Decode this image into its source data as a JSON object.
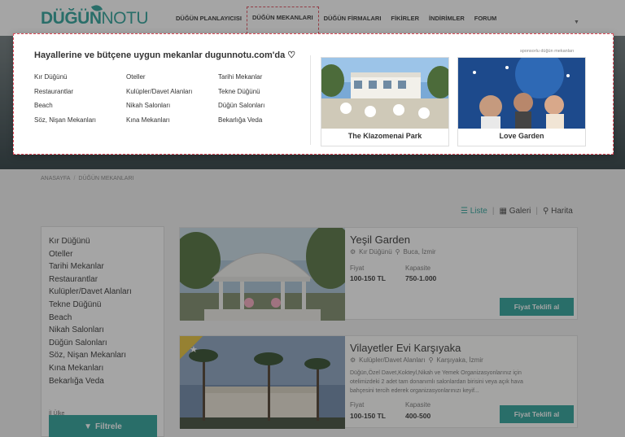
{
  "header": {
    "logo_main": "DÜĞÜN",
    "logo_second": "NOTU",
    "nav": [
      {
        "label": "DÜĞÜN PLANLAYICISI"
      },
      {
        "label": "DÜĞÜN MEKANLARI"
      },
      {
        "label": "DÜĞÜN FİRMALARI"
      },
      {
        "label": "FİKİRLER"
      },
      {
        "label": "İNDİRİMLER"
      },
      {
        "label": "FORUM"
      }
    ]
  },
  "mega_menu": {
    "title": "Hayallerine ve bütçene uygun mekanlar dugunnotu.com'da ♡",
    "col1": [
      "Kır Düğünü",
      "Restaurantlar",
      "Beach",
      "Söz, Nişan Mekanları"
    ],
    "col2": [
      "Oteller",
      "Kulüpler/Davet Alanları",
      "Nikah Salonları",
      "Kına Mekanları"
    ],
    "col3": [
      "Tarihi Mekanlar",
      "Tekne Düğünü",
      "Düğün Salonları",
      "Bekarlığa Veda"
    ],
    "sponsor_label": "sponsorlu düğün mekanları",
    "sponsors": [
      {
        "name": "The Klazomenai Park"
      },
      {
        "name": "Love Garden"
      }
    ]
  },
  "breadcrumb": {
    "home": "ANASAYFA",
    "sep": "/",
    "current": "DÜĞÜN MEKANLARI"
  },
  "view_switch": {
    "list": "Liste",
    "gallery": "Galeri",
    "map": "Harita",
    "bar": "|"
  },
  "sidebar": {
    "items": [
      "Kır Düğünü",
      "Oteller",
      "Tarihi Mekanlar",
      "Restaurantlar",
      "Kulüpler/Davet Alanları",
      "Tekne Düğünü",
      "Beach",
      "Nikah Salonları",
      "Düğün Salonları",
      "Söz, Nişan Mekanları",
      "Kına Mekanları",
      "Bekarlığa Veda"
    ],
    "extra": "İl Ülke",
    "filter_label": "Filtrele"
  },
  "listings": [
    {
      "title": "Yeşil Garden",
      "category": "Kır Düğünü",
      "location": "Buca, İzmir",
      "description": "",
      "price_label": "Fiyat",
      "price": "100-150 TL",
      "capacity_label": "Kapasite",
      "capacity": "750-1.000",
      "button": "Fiyat Teklifi al"
    },
    {
      "title": "Vilayetler Evi Karşıyaka",
      "category": "Kulüpler/Davet Alanları",
      "location": "Karşıyaka, İzmir",
      "description": "Düğün,Özel Davet,Kokteyl,Nikah ve Yemek Organizasyonlarınız için otelimizdeki 2 adet tam donanımlı salonlardan birisini veya açık hava bahçesini tercih ederek organizasyonlarınızı keyif...",
      "price_label": "Fiyat",
      "price": "100-150 TL",
      "capacity_label": "Kapasite",
      "capacity": "400-500",
      "button": "Fiyat Teklifi al"
    }
  ],
  "colors": {
    "accent": "#2aa198",
    "highlight": "#e04b5a",
    "ribbon": "#e6c13a"
  }
}
